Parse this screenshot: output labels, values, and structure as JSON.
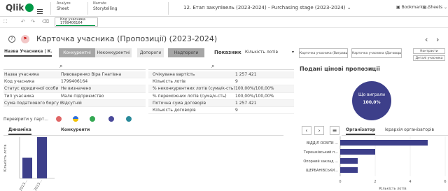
{
  "topbar": {
    "logo": "Qlik",
    "analyze_label": "Analyze",
    "analyze_value": "Sheet",
    "narrate_label": "Narrate",
    "narrate_value": "Storytelling",
    "app_title": "12. Етап закупівель (2023-2024) - Purchasing stage (2023-2024)",
    "bookmarks": "Bookmarks",
    "sheets": "Sheets"
  },
  "selection": {
    "field": "Код учасника",
    "value": "1799406164"
  },
  "sheet": {
    "title": "Карточка учасника (Пропозиції) (2023-2024)"
  },
  "filters": {
    "participant_name": "Назва Учасника | К...",
    "btn_competitive": "Конкурентні",
    "btn_noncompetitive": "Неконкурентні",
    "btn_thresholds": "Допороги",
    "btn_above": "Надпороги",
    "indicator_label": "Показник",
    "indicator_value": "Кількість лотів",
    "btn_contract_prices": "Карточка учасника (Договори)",
    "btn_contract_prices_left": "Карточка учасника (Вигравші)",
    "btn_contacts": "Контракти",
    "btn_participant_details": "Деталі учасника"
  },
  "left_table": {
    "rows": [
      {
        "label": "Назва учасника",
        "value": "Пивоваренко Віра Гнатівна"
      },
      {
        "label": "Код учасника",
        "value": "1799406164"
      },
      {
        "label": "Статус юридичної особи",
        "value": "Не визначено"
      },
      {
        "label": "Тип учасника",
        "value": "Мале підприємство"
      },
      {
        "label": "Сума податкового боргу (на",
        "value": "Відсутній"
      }
    ]
  },
  "mid_table": {
    "rows": [
      {
        "label": "Очікувана вартість",
        "value": "1 257 421"
      },
      {
        "label": "Кількість лотів",
        "value": "9"
      },
      {
        "label": "% неконкурентних лотів (сума/к-сть)",
        "value": "100,00%/100,00%"
      },
      {
        "label": "% переможних лотів (сума/к-сть)",
        "value": "100,00%/100,00%"
      },
      {
        "label": "Поточна сума договорів",
        "value": "1 257 421"
      },
      {
        "label": "Кількість договорів",
        "value": "9"
      }
    ]
  },
  "check": {
    "label": "Перевірити у парт..."
  },
  "dynamics": {
    "tab_dynamics": "Динаміка",
    "tab_competitors": "Конкуренти",
    "ylabel": "Кількість лотів",
    "x_labels": [
      "2023...",
      "2023..."
    ]
  },
  "right_panel": {
    "title": "Подані цінові пропозиції",
    "circle_label": "Що виграли",
    "circle_value": "100,0%",
    "tab_organizer": "Організатор",
    "tab_hierarchy": "Ієрархія організаторів",
    "x_axis_label": "Кількість лотів"
  },
  "colors": {
    "accent_green": "#009845",
    "bar_blue": "#3d3f8a",
    "circle_bg": "#3d3f8a"
  },
  "chart_data": [
    {
      "type": "bar",
      "categories": [
        "2023...",
        "2023..."
      ],
      "values": [
        3,
        6
      ],
      "ylabel": "Кількість лотів",
      "ylim": [
        0,
        6
      ]
    },
    {
      "type": "bar",
      "orientation": "horizontal",
      "categories": [
        "ВІДДІЛ ОСВІТИ ...",
        "Терешківський п...",
        "Опорний заклад ...",
        "ЩЕРБАНІВСЬКИ..."
      ],
      "values": [
        5,
        2,
        1,
        1
      ],
      "xlabel": "Кількість лотів",
      "xlim": [
        0,
        6
      ],
      "x_ticks": [
        0,
        2,
        4,
        6
      ]
    }
  ]
}
